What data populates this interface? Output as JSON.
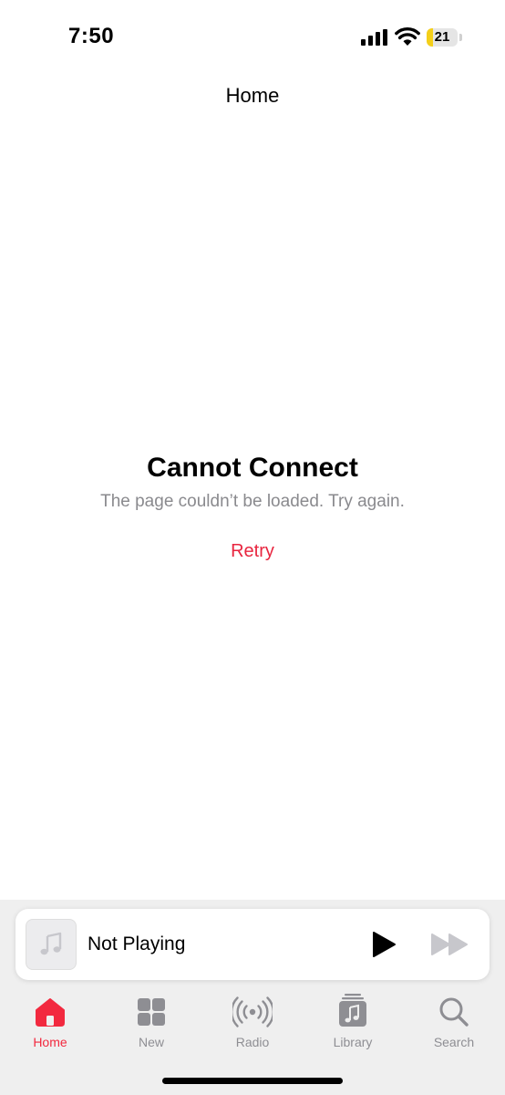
{
  "status_bar": {
    "time": "7:50",
    "battery_level": "21",
    "battery_fraction": 0.21,
    "battery_color": "#f4cf19"
  },
  "nav": {
    "title": "Home"
  },
  "error": {
    "title": "Cannot Connect",
    "message": "The page couldn’t be loaded. Try again.",
    "retry_label": "Retry"
  },
  "mini_player": {
    "artwork_icon": "music-note-icon",
    "title": "Not Playing",
    "play_icon": "play-icon",
    "forward_icon": "forward-icon"
  },
  "tabs": [
    {
      "label": "Home",
      "icon": "home-icon",
      "active": true
    },
    {
      "label": "New",
      "icon": "grid-icon",
      "active": false
    },
    {
      "label": "Radio",
      "icon": "radio-icon",
      "active": false
    },
    {
      "label": "Library",
      "icon": "library-icon",
      "active": false
    },
    {
      "label": "Search",
      "icon": "search-icon",
      "active": false
    }
  ],
  "colors": {
    "accent": "#f2293f",
    "retry": "#e8253f",
    "inactive": "#8e8e93"
  }
}
